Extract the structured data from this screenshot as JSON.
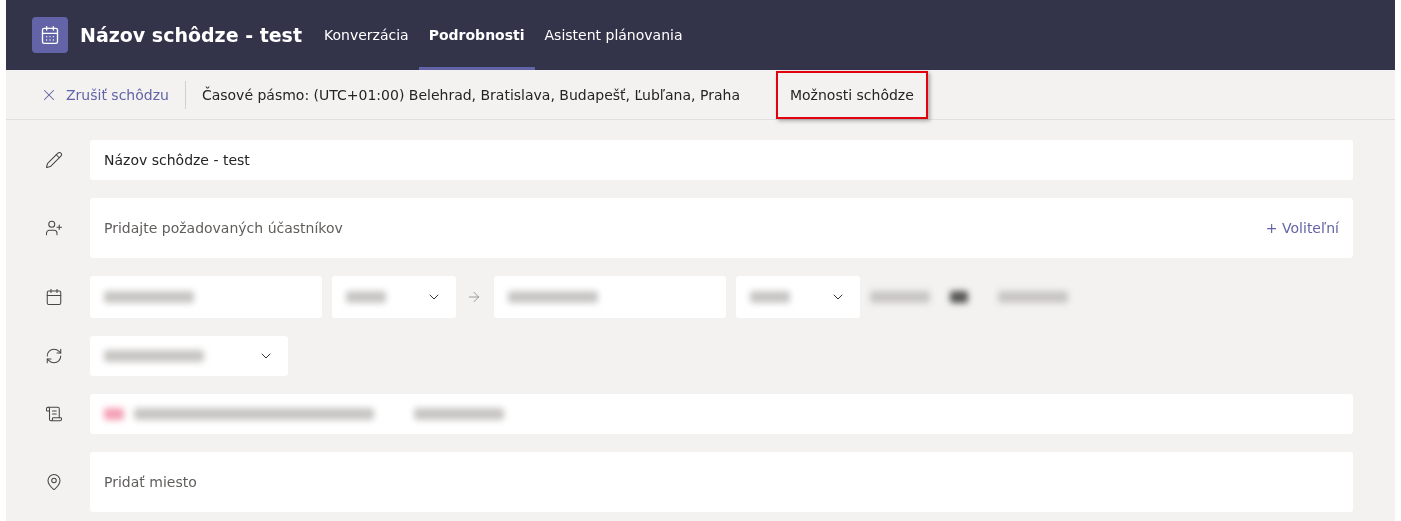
{
  "header": {
    "title": "Názov schôdze - test",
    "tabs": [
      {
        "label": "Konverzácia",
        "selected": false
      },
      {
        "label": "Podrobnosti",
        "selected": true
      },
      {
        "label": "Asistent plánovania",
        "selected": false
      }
    ]
  },
  "toolbar": {
    "cancel": "Zrušiť schôdzu",
    "timezone": "Časové pásmo: (UTC+01:00) Belehrad, Bratislava, Budapešť, Ľubľana, Praha",
    "options": {
      "label": "Možnosti schôdze",
      "highlighted": true
    }
  },
  "form": {
    "title": {
      "value": "Názov schôdze - test"
    },
    "attendees": {
      "placeholder": "Pridajte požadovaných účastníkov",
      "optional": "+ Voliteľní"
    },
    "location": {
      "placeholder": "Pridať miesto"
    }
  }
}
